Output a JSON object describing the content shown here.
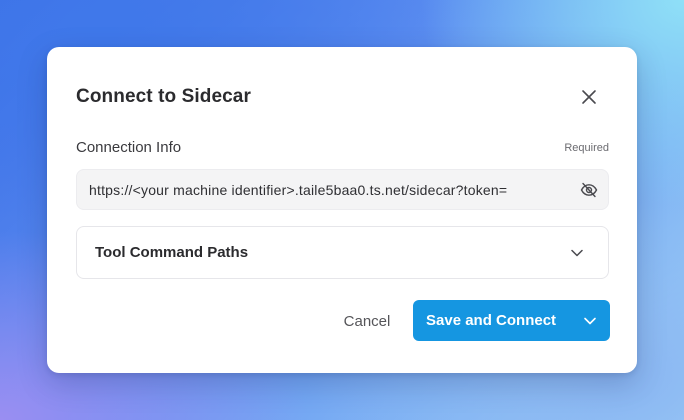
{
  "dialog": {
    "title": "Connect to Sidecar",
    "close_icon": "close-icon"
  },
  "connection": {
    "label": "Connection Info",
    "required_label": "Required",
    "value": "https://<your machine identifier>.taile5baa0.ts.net/sidecar?token=",
    "visibility_icon": "eye-off-icon"
  },
  "tool_paths": {
    "label": "Tool Command Paths",
    "expanded": false,
    "chevron_icon": "chevron-down-icon"
  },
  "footer": {
    "cancel_label": "Cancel",
    "primary_label": "Save and Connect",
    "primary_dropdown_icon": "chevron-down-icon"
  },
  "colors": {
    "primary": "#1596e1",
    "dialog_bg": "#ffffff",
    "input_bg": "#f4f4f5"
  }
}
